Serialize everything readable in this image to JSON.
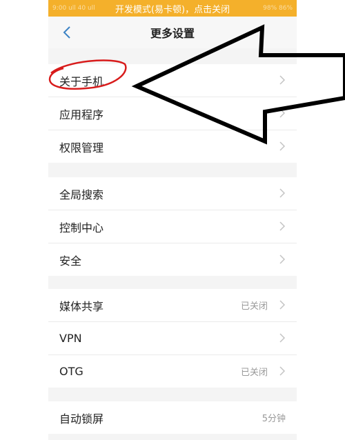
{
  "status_bar": {
    "text": "开发模式(易卡顿)，点击关闭",
    "left_ghost": "9:00 ull 40 ull",
    "right_ghost": "98% 86%"
  },
  "header": {
    "title": "更多设置"
  },
  "groups": [
    {
      "items": [
        {
          "label": "关于手机",
          "value": ""
        },
        {
          "label": "应用程序",
          "value": ""
        },
        {
          "label": "权限管理",
          "value": ""
        }
      ]
    },
    {
      "items": [
        {
          "label": "全局搜索",
          "value": ""
        },
        {
          "label": "控制中心",
          "value": ""
        },
        {
          "label": "安全",
          "value": ""
        }
      ]
    },
    {
      "items": [
        {
          "label": "媒体共享",
          "value": "已关闭"
        },
        {
          "label": "VPN",
          "value": ""
        },
        {
          "label": "OTG",
          "value": "已关闭"
        }
      ]
    },
    {
      "items": [
        {
          "label": "自动锁屏",
          "value": "5分钟"
        }
      ]
    }
  ],
  "colors": {
    "dev_bar": "#f4b02b",
    "back_arrow": "#3b82c4",
    "annotation_circle": "#d81b1b"
  },
  "icons": {
    "back": "back-arrow-icon",
    "chevron": "chevron-right-icon"
  }
}
